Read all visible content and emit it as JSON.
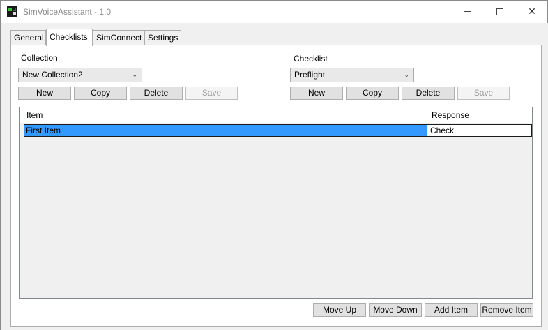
{
  "window": {
    "title": "SimVoiceAssistant - 1.0",
    "minimize_glyph": "",
    "close_glyph": "✕"
  },
  "tabs": [
    {
      "label": "General",
      "active": false
    },
    {
      "label": "Checklists",
      "active": true
    },
    {
      "label": "SimConnect",
      "active": false
    },
    {
      "label": "Settings",
      "active": false
    }
  ],
  "collection": {
    "label": "Collection",
    "selected": "New Collection2",
    "buttons": {
      "new": "New",
      "copy": "Copy",
      "delete": "Delete",
      "save": "Save"
    }
  },
  "checklist": {
    "label": "Checklist",
    "selected": "Preflight",
    "buttons": {
      "new": "New",
      "copy": "Copy",
      "delete": "Delete",
      "save": "Save"
    }
  },
  "grid": {
    "columns": [
      "Item",
      "Response"
    ],
    "rows": [
      {
        "item": "First Item",
        "response": "Check",
        "selected": true
      }
    ]
  },
  "actions": {
    "move_up": "Move Up",
    "move_down": "Move Down",
    "add_item": "Add Item",
    "remove_item": "Remove Item"
  },
  "icons": {
    "app": "app-icon",
    "dropdown": "chevron-down-icon"
  }
}
